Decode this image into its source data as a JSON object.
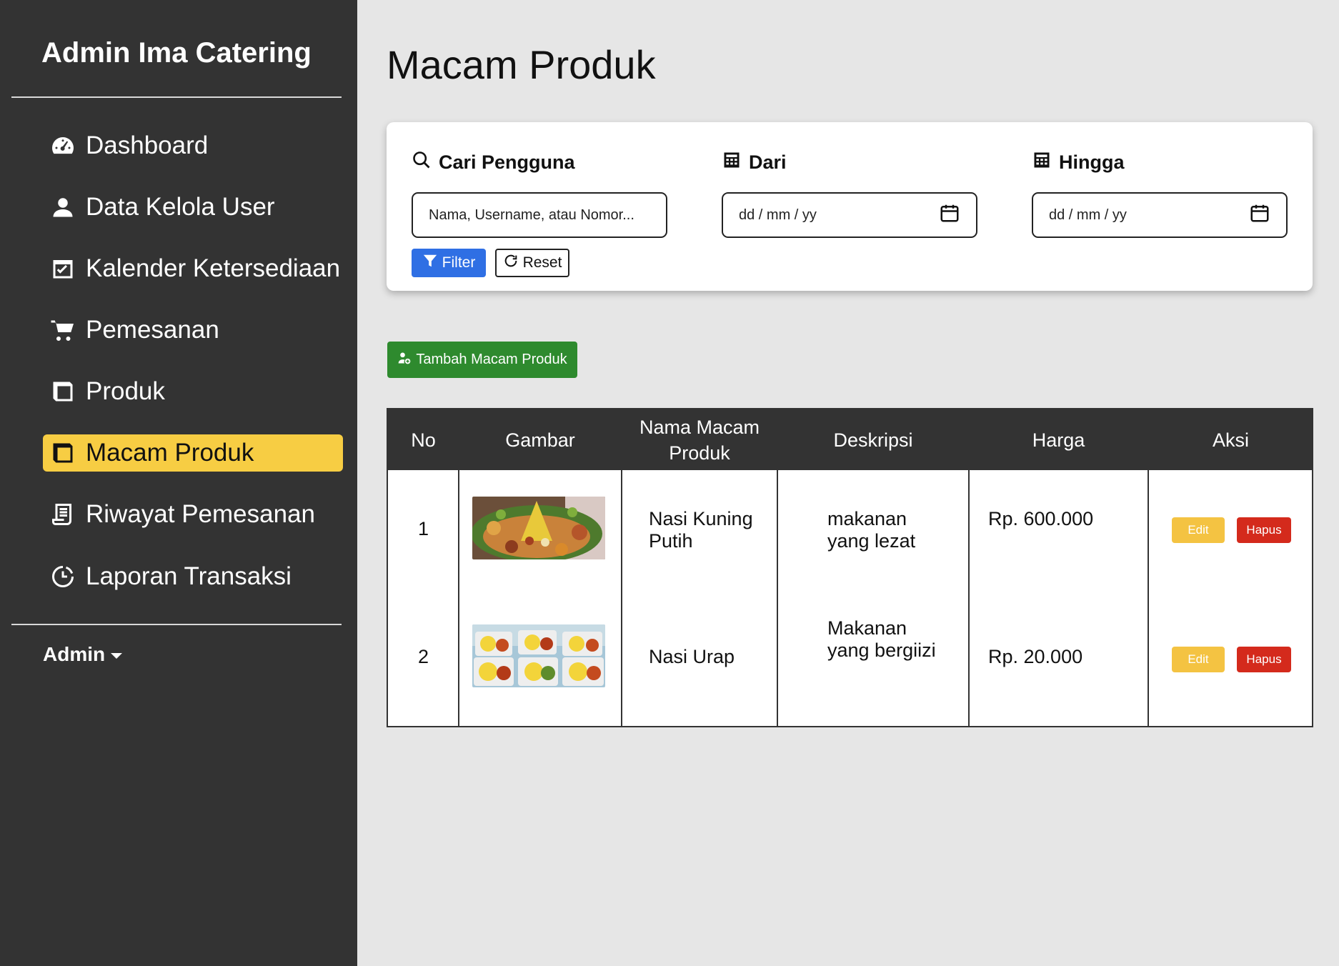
{
  "sidebar": {
    "brand": "Admin Ima Catering",
    "items": [
      {
        "label": "Dashboard",
        "icon": "dashboard-icon"
      },
      {
        "label": "Data Kelola User",
        "icon": "user-icon"
      },
      {
        "label": "Kalender Ketersediaan",
        "icon": "calendar-check-icon"
      },
      {
        "label": "Pemesanan",
        "icon": "cart-icon"
      },
      {
        "label": "Produk",
        "icon": "box-icon"
      },
      {
        "label": "Macam Produk",
        "icon": "box-icon",
        "active": true
      },
      {
        "label": "Riwayat Pemesanan",
        "icon": "receipt-icon"
      },
      {
        "label": "Laporan Transaksi",
        "icon": "history-icon"
      }
    ],
    "user_menu": "Admin"
  },
  "main": {
    "title": "Macam Produk",
    "filter": {
      "search_label": "Cari Pengguna",
      "search_placeholder": "Nama, Username, atau Nomor...",
      "from_label": "Dari",
      "from_placeholder": "dd / mm / yy",
      "to_label": "Hingga",
      "to_placeholder": "dd / mm / yy",
      "filter_button": "Filter",
      "reset_button": "Reset"
    },
    "add_button": "Tambah Macam Produk",
    "table": {
      "headers": [
        "No",
        "Gambar",
        "Nama Macam Produk",
        "Deskripsi",
        "Harga",
        "Aksi"
      ],
      "rows": [
        {
          "no": "1",
          "image": "tumpeng-nasi-kuning-photo",
          "name": "Nasi Kuning Putih",
          "description": "makanan yang lezat",
          "price": "Rp. 600.000",
          "edit": "Edit",
          "delete": "Hapus"
        },
        {
          "no": "2",
          "image": "nasi-box-photo",
          "name": "Nasi Urap",
          "description": "Makanan yang bergiizi",
          "price": "Rp. 20.000",
          "edit": "Edit",
          "delete": "Hapus"
        }
      ]
    }
  },
  "colors": {
    "sidebar_bg": "#333333",
    "active_nav": "#f7cd43",
    "filter_button": "#2f6fe4",
    "add_button": "#2e8a2e",
    "edit_button": "#f4c342",
    "delete_button": "#d42a1c",
    "page_bg": "#e6e6e6"
  }
}
